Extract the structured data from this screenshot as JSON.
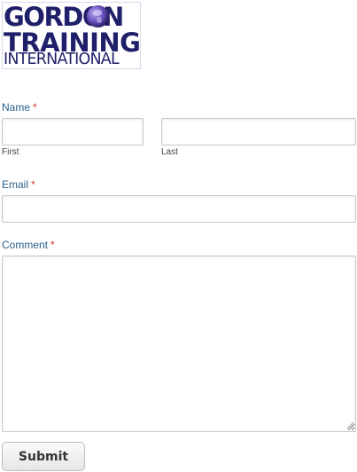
{
  "logo": {
    "line1": "GORDON",
    "line2": "TRAINING",
    "line3": "INTERNATIONAL"
  },
  "form": {
    "name": {
      "label": "Name",
      "required_mark": "*",
      "first_sublabel": "First",
      "last_sublabel": "Last",
      "first_value": "",
      "last_value": ""
    },
    "email": {
      "label": "Email",
      "required_mark": "*",
      "value": ""
    },
    "comment": {
      "label": "Comment",
      "required_mark": "*",
      "value": ""
    },
    "submit_label": "Submit"
  },
  "colors": {
    "label": "#2b5f8a",
    "required": "#d2342b",
    "logo_text": "#1f1f6a",
    "globe": "#6f55c4"
  },
  "icons": {
    "globe": "globe-icon",
    "resize": "resize-grip-icon"
  }
}
